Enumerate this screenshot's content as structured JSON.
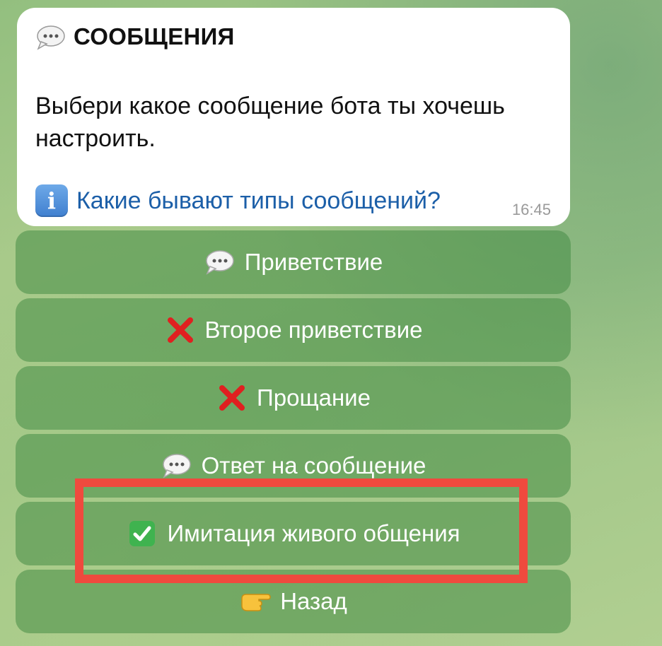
{
  "message": {
    "title": "СООБЩЕНИЯ",
    "title_icon": "speech-balloon-icon",
    "body": "Выбери какое сообщение бота ты хочешь настроить.",
    "info_icon": "info-icon",
    "info_link": "Какие бывают типы сообщений?",
    "time": "16:45"
  },
  "keyboard": {
    "buttons": [
      {
        "label": "Приветствие",
        "icon": "speech-balloon-icon"
      },
      {
        "label": "Второе приветствие",
        "icon": "red-cross-icon"
      },
      {
        "label": "Прощание",
        "icon": "red-cross-icon"
      },
      {
        "label": "Ответ на сообщение",
        "icon": "speech-balloon-icon"
      },
      {
        "label": "Имитация живого общения",
        "icon": "green-check-icon"
      },
      {
        "label": "Назад",
        "icon": "pointing-hand-icon"
      }
    ]
  },
  "colors": {
    "highlight": "#ef4a3e",
    "link": "#1c5fa8",
    "button_bg": "#6a9e5c"
  }
}
